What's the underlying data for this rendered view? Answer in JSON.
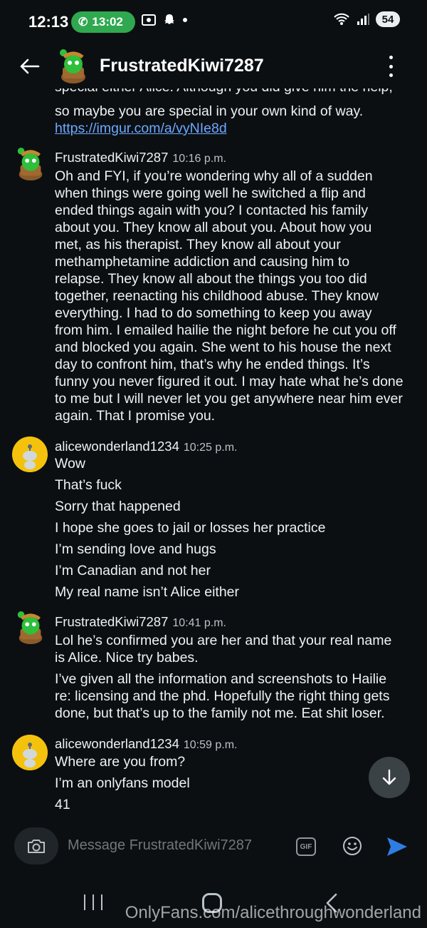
{
  "status_bar": {
    "time": "12:13",
    "call_duration": "13:02",
    "battery": "54"
  },
  "header": {
    "title": "FrustratedKiwi7287"
  },
  "clipped_text": "special either Alice. Although you did give him the help,",
  "messages": [
    {
      "id": "m0",
      "continuation": true,
      "lines": [
        "so maybe you are special in your own kind of way."
      ],
      "link": "https://imgur.com/a/vyNIe8d"
    },
    {
      "id": "m1",
      "author": "FrustratedKiwi7287",
      "time": "10:16 p.m.",
      "lines": [
        "Oh and FYI, if you’re wondering why all of a sudden",
        "when things were going well he switched a flip and",
        "ended things again with you? I contacted his family",
        "about you. They know all about you. About how you",
        "met, as his therapist. They know all about your",
        "methamphetamine addiction and causing him to",
        "relapse. They know all about the things you too did",
        "together, reenacting his childhood abuse. They know",
        "everything. I had to do something to keep you away",
        "from him. I emailed hailie the night before he cut you off",
        "and blocked you again. She went to his house the next",
        "day to confront him, that’s why he ended things. It’s",
        "funny you never figured it out. I may hate what he’s done",
        "to me but I will never let you get anywhere near him ever",
        "again. That I promise you."
      ]
    },
    {
      "id": "m2",
      "author": "alicewonderland1234",
      "time": "10:25 p.m.",
      "lines": [
        "Wow",
        "That’s fuck",
        "Sorry that happened",
        "I hope she goes to jail or losses her practice",
        "I’m sending love and hugs",
        "I’m Canadian and not her",
        "My real name isn’t Alice either"
      ]
    },
    {
      "id": "m3",
      "author": "FrustratedKiwi7287",
      "time": "10:41 p.m.",
      "lines": [
        "Lol he’s confirmed you are her and that your real name",
        "is Alice. Nice try babes.",
        "I’ve given all the information and screenshots to Hailie",
        "re: licensing and the phd. Hopefully the right thing gets",
        "done, but that’s up to the family not me. Eat shit loser."
      ]
    },
    {
      "id": "m4",
      "author": "alicewonderland1234",
      "time": "10:59 p.m.",
      "lines": [
        "Where are you from?",
        "I’m an onlyfans model",
        "41"
      ]
    }
  ],
  "composer": {
    "placeholder": "Message FrustratedKiwi7287",
    "gif_label": "GIF"
  },
  "watermark": "OnlyFans.com/alicethroughwonderland",
  "colors": {
    "background": "#0b0f12",
    "call_pill": "#2fa84f",
    "link": "#6ea8ff",
    "send": "#2f7de1",
    "kiwi_green": "#2fbf3b",
    "alice_yellow": "#f4c20d"
  },
  "icons": [
    "back-arrow-icon",
    "more-vert-icon",
    "phone-icon",
    "camera-icon",
    "gif-icon",
    "emoji-icon",
    "send-icon",
    "arrow-down-icon",
    "wifi-icon",
    "signal-icon"
  ]
}
